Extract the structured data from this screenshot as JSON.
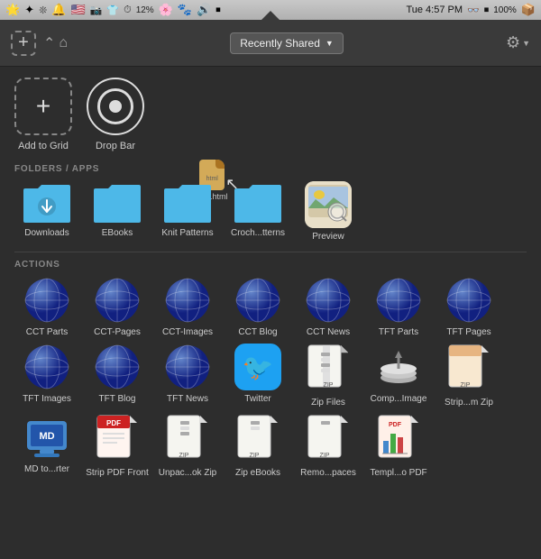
{
  "menubar": {
    "time": "Tue 4:57 PM",
    "battery": "100%",
    "wifi": "12%"
  },
  "toolbar": {
    "add_label": "+",
    "dropdown_label": "Recently Shared",
    "dropdown_arrow": "▼",
    "gear_label": "⚙",
    "gear_arrow": "▼"
  },
  "action_items": [
    {
      "id": "add-to-grid",
      "label": "Add to Grid",
      "type": "plus"
    },
    {
      "id": "drop-bar",
      "label": "Drop Bar",
      "type": "target"
    }
  ],
  "sections": {
    "folders": {
      "label": "FOLDERS / APPS",
      "items": [
        {
          "id": "downloads",
          "label": "Downloads",
          "type": "folder-download"
        },
        {
          "id": "ebooks",
          "label": "EBooks",
          "type": "folder"
        },
        {
          "id": "knit-patterns",
          "label": "Knit Patterns",
          "type": "folder"
        },
        {
          "id": "crochet-patterns",
          "label": "Croch...tterns",
          "type": "folder"
        },
        {
          "id": "preview",
          "label": "Preview",
          "type": "preview"
        }
      ]
    },
    "actions": {
      "label": "ACTIONS",
      "items": [
        {
          "id": "cct-parts",
          "label": "CCT Parts",
          "type": "globe"
        },
        {
          "id": "cct-pages",
          "label": "CCT-Pages",
          "type": "globe"
        },
        {
          "id": "cct-images",
          "label": "CCT-Images",
          "type": "globe"
        },
        {
          "id": "cct-blog",
          "label": "CCT Blog",
          "type": "globe"
        },
        {
          "id": "cct-news",
          "label": "CCT News",
          "type": "globe"
        },
        {
          "id": "tft-parts",
          "label": "TFT Parts",
          "type": "globe"
        },
        {
          "id": "tft-pages",
          "label": "TFT Pages",
          "type": "globe"
        },
        {
          "id": "tft-images",
          "label": "TFT Images",
          "type": "globe"
        },
        {
          "id": "tft-blog",
          "label": "TFT Blog",
          "type": "globe"
        },
        {
          "id": "tft-news",
          "label": "TFT News",
          "type": "globe"
        },
        {
          "id": "twitter",
          "label": "Twitter",
          "type": "twitter"
        },
        {
          "id": "zip-files",
          "label": "Zip Files",
          "type": "zip"
        },
        {
          "id": "comp-image",
          "label": "Comp...Image",
          "type": "comp"
        },
        {
          "id": "strip-zip",
          "label": "Strip...m Zip",
          "type": "strip-zip"
        },
        {
          "id": "md-converter",
          "label": "MD to...rter",
          "type": "md"
        },
        {
          "id": "strip-pdf",
          "label": "Strip PDF Front",
          "type": "strip-pdf"
        },
        {
          "id": "unpack-zip",
          "label": "Unpac...ok Zip",
          "type": "unpack"
        },
        {
          "id": "zip-ebooks",
          "label": "Zip eBooks",
          "type": "zip2"
        },
        {
          "id": "remo-spaces",
          "label": "Remo...paces",
          "type": "zip3"
        },
        {
          "id": "templ-pdf",
          "label": "Templ...o PDF",
          "type": "templ"
        }
      ]
    }
  }
}
